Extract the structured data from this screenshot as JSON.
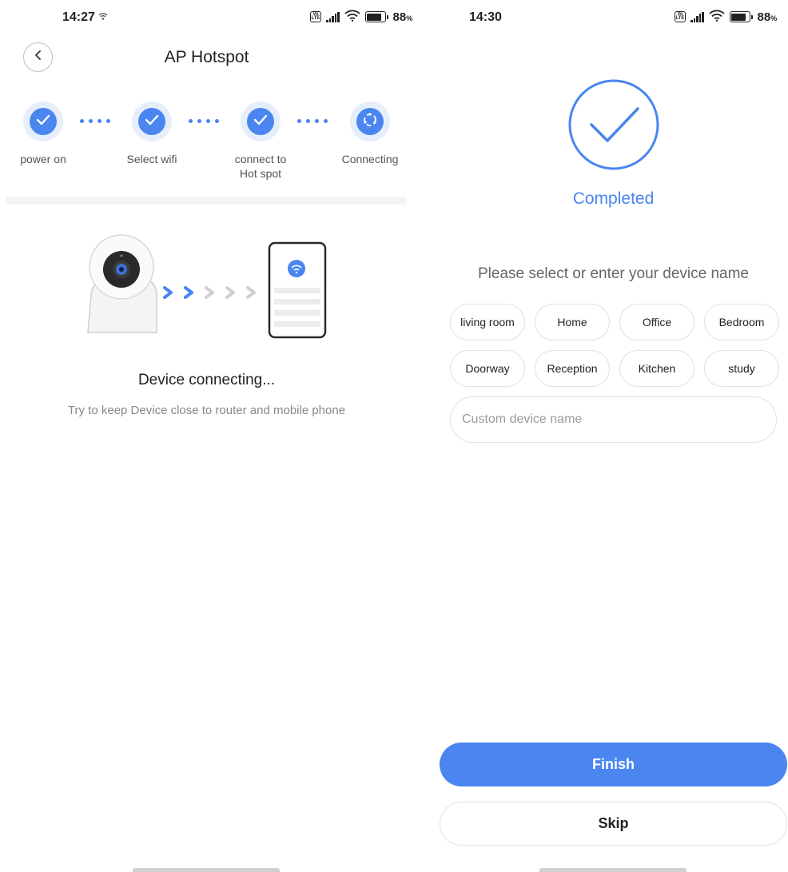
{
  "left_screen": {
    "status_bar": {
      "time": "14:27",
      "battery_percent": "88",
      "battery_unit": "%"
    },
    "header": {
      "title": "AP Hotspot",
      "back_icon": "chevron-left-icon"
    },
    "steps": [
      {
        "label": "power on",
        "icon": "check-icon"
      },
      {
        "label": "Select wifi",
        "icon": "check-icon"
      },
      {
        "label": "connect to",
        "label_line2": "Hot spot",
        "icon": "check-icon"
      },
      {
        "label": "Connecting",
        "icon": "loading-icon"
      }
    ],
    "status": {
      "title": "Device connecting...",
      "hint": "Try to keep Device close to router and mobile phone"
    }
  },
  "right_screen": {
    "status_bar": {
      "time": "14:30",
      "battery_percent": "88",
      "battery_unit": "%"
    },
    "completed_label": "Completed",
    "prompt": "Please select or enter your device name",
    "name_options": [
      "living room",
      "Home",
      "Office",
      "Bedroom",
      "Doorway",
      "Reception",
      "Kitchen",
      "study"
    ],
    "custom_name": {
      "placeholder": "Custom device name",
      "value": ""
    },
    "finish_label": "Finish",
    "skip_label": "Skip"
  },
  "colors": {
    "accent": "#4a85f0",
    "accent_light": "#e6eefc",
    "chip_border": "#e2e2e2"
  }
}
